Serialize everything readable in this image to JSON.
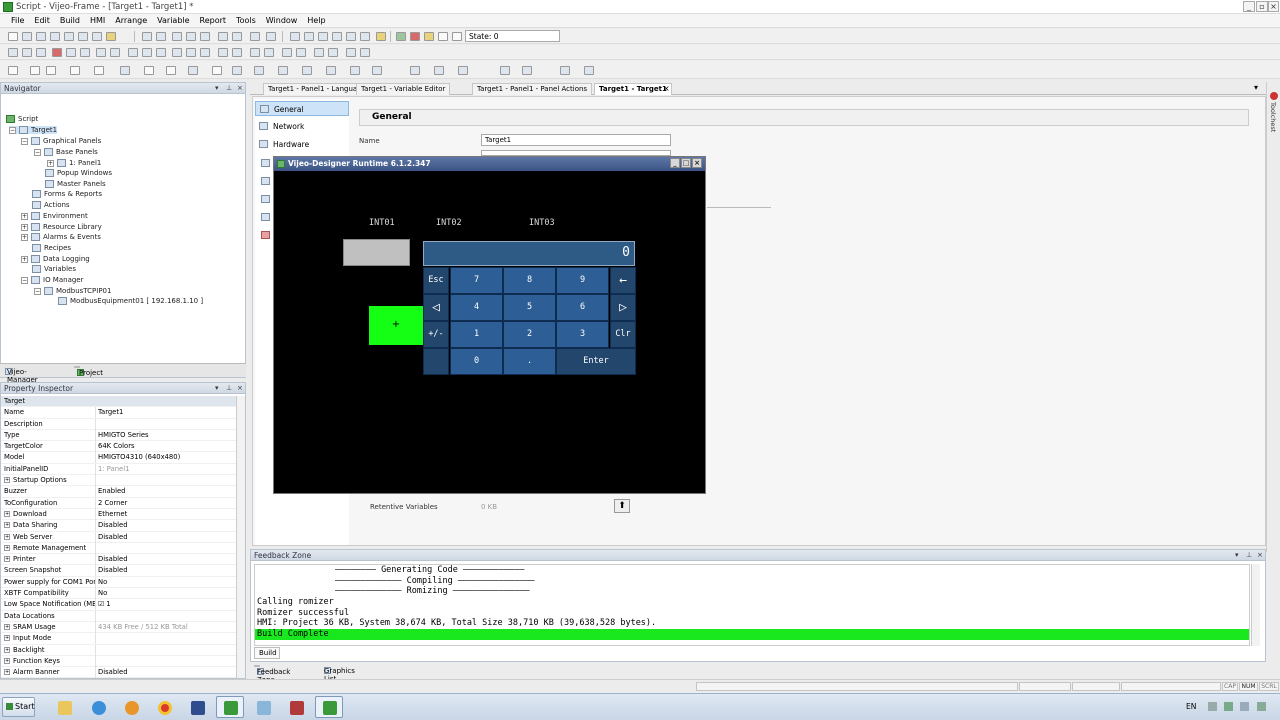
{
  "window": {
    "title": "Script - Vijeo-Frame - [Target1 - Target1] *"
  },
  "menu": [
    "File",
    "Edit",
    "Build",
    "HMI",
    "Arrange",
    "Variable",
    "Report",
    "Tools",
    "Window",
    "Help"
  ],
  "toolbar": {
    "state_label": "State: 0"
  },
  "navigator": {
    "title": "Navigator",
    "items": [
      "Script",
      "Target1",
      "Graphical Panels",
      "Base Panels",
      "1: Panel1",
      "Popup Windows",
      "Master Panels",
      "Forms & Reports",
      "Actions",
      "Environment",
      "Resource Library",
      "Alarms & Events",
      "Recipes",
      "Data Logging",
      "Variables",
      "IO Manager",
      "ModbusTCPIP01",
      "ModbusEquipment01 [ 192.168.1.10 ]"
    ],
    "tabs": [
      "Vijeo-Manager",
      "Project"
    ]
  },
  "property_inspector": {
    "title": "Property Inspector",
    "header": "Target",
    "rows": [
      {
        "name": "Name",
        "value": "Target1"
      },
      {
        "name": "Description",
        "value": ""
      },
      {
        "name": "Type",
        "value": "HMIGTO Series"
      },
      {
        "name": "TargetColor",
        "value": "64K Colors"
      },
      {
        "name": "Model",
        "value": "HMIGTO4310 (640x480)"
      },
      {
        "name": "InitialPanelID",
        "value": "1: Panel1"
      },
      {
        "name": "Startup Options",
        "value": ""
      },
      {
        "name": "Buzzer",
        "value": "Enabled"
      },
      {
        "name": "ToConfiguration",
        "value": "2 Corner"
      },
      {
        "name": "Download",
        "value": "Ethernet"
      },
      {
        "name": "Data Sharing",
        "value": "Disabled"
      },
      {
        "name": "Web Server",
        "value": "Disabled"
      },
      {
        "name": "Remote Management",
        "value": ""
      },
      {
        "name": "Printer",
        "value": "Disabled"
      },
      {
        "name": "Screen Snapshot",
        "value": "Disabled"
      },
      {
        "name": "Power supply for COM1 Port",
        "value": "No"
      },
      {
        "name": "XBTF Compatibility",
        "value": "No"
      },
      {
        "name": "Low Space Notification (MB)",
        "value": "1"
      },
      {
        "name": "Data Locations",
        "value": ""
      },
      {
        "name": "SRAM Usage",
        "value": "434 KB Free / 512 KB Total"
      },
      {
        "name": "Input Mode",
        "value": ""
      },
      {
        "name": "Backlight",
        "value": ""
      },
      {
        "name": "Function Keys",
        "value": ""
      },
      {
        "name": "Alarm Banner",
        "value": "Disabled"
      }
    ]
  },
  "doc_tabs": [
    "Target1 - Panel1 - Language1",
    "Target1 - Variable Editor",
    "Target1 - Panel1 - Panel Actions",
    "Target1 - Target1"
  ],
  "editor": {
    "categories": [
      "General",
      "Network",
      "Hardware"
    ],
    "section_title": "General",
    "name_label": "Name",
    "name_value": "Target1",
    "retentive_label": "Retentive Variables",
    "retentive_value": "0 KB"
  },
  "runtime": {
    "title": "Vijeo-Designer Runtime 6.1.2.347",
    "labels": [
      "INT01",
      "INT02",
      "INT03"
    ],
    "plus": "+",
    "display_value": "0",
    "keys": [
      "Esc",
      "7",
      "8",
      "9",
      "←",
      "◁",
      "4",
      "5",
      "6",
      "▷",
      "+/-",
      "1",
      "2",
      "3",
      "Clr",
      "0",
      ".",
      "Enter"
    ]
  },
  "feedback": {
    "title": "Feedback Zone",
    "lines": [
      "Generating Code",
      "Compiling",
      "Romizing",
      "Calling romizer",
      "Romizer successful",
      "HMI: Project 36 KB, System 38,674 KB, Total Size 38,710 KB (39,638,528 bytes).",
      "Build Complete"
    ],
    "build_tab": "Build",
    "tabs": [
      "Feedback Zone",
      "Graphics List"
    ]
  },
  "right_strip": {
    "label": "Toolchest"
  },
  "statusbar": [
    "CAP",
    "NUM",
    "SCRL"
  ],
  "taskbar": {
    "start": "Start",
    "lang": "EN"
  }
}
